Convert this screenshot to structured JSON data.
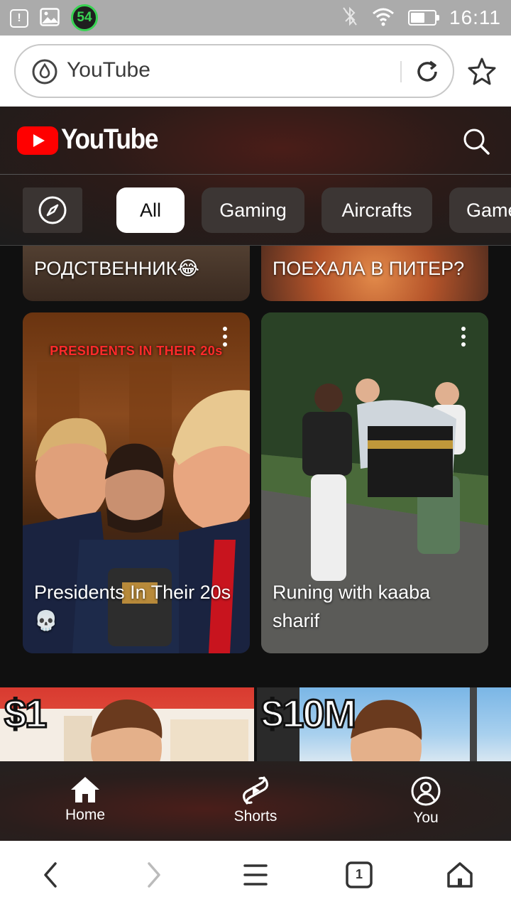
{
  "status_bar": {
    "badge_count": "54",
    "time": "16:11",
    "battery_level": 0.6,
    "left_icons": [
      "alert-icon",
      "image-icon"
    ],
    "right_icons": [
      "bluetooth-off-icon",
      "wifi-icon",
      "battery-icon"
    ]
  },
  "browser": {
    "url_text": "YouTube",
    "icons": [
      "site-shield-icon",
      "reload-icon",
      "bookmark-star-icon"
    ]
  },
  "youtube": {
    "wordmark": "YouTube",
    "chips": [
      "All",
      "Gaming",
      "Aircrafts",
      "Game"
    ],
    "active_chip": "All",
    "accent_color": "#ff0000"
  },
  "feed": {
    "partial_cards": [
      {
        "title": "РОДСТВЕННИК😂"
      },
      {
        "title": "ПОЕХАЛА В ПИТЕР?"
      }
    ],
    "shorts": [
      {
        "title": "Presidents In Their 20s",
        "emoji": "💀",
        "overlay_text": "PRESIDENTS IN THEIR 20s"
      },
      {
        "title": "Runing with kaaba sharif"
      }
    ],
    "bottom_thumbs": [
      {
        "overlay_text": "$1"
      },
      {
        "overlay_text": "$10M"
      }
    ]
  },
  "yt_nav": {
    "items": [
      {
        "label": "Home",
        "icon": "home-icon"
      },
      {
        "label": "Shorts",
        "icon": "shorts-icon"
      },
      {
        "label": "You",
        "icon": "account-icon"
      }
    ]
  },
  "browser_nav": {
    "tab_count": "1",
    "icons": [
      "back-icon",
      "forward-icon",
      "menu-icon",
      "tabs-icon",
      "home-icon"
    ]
  }
}
